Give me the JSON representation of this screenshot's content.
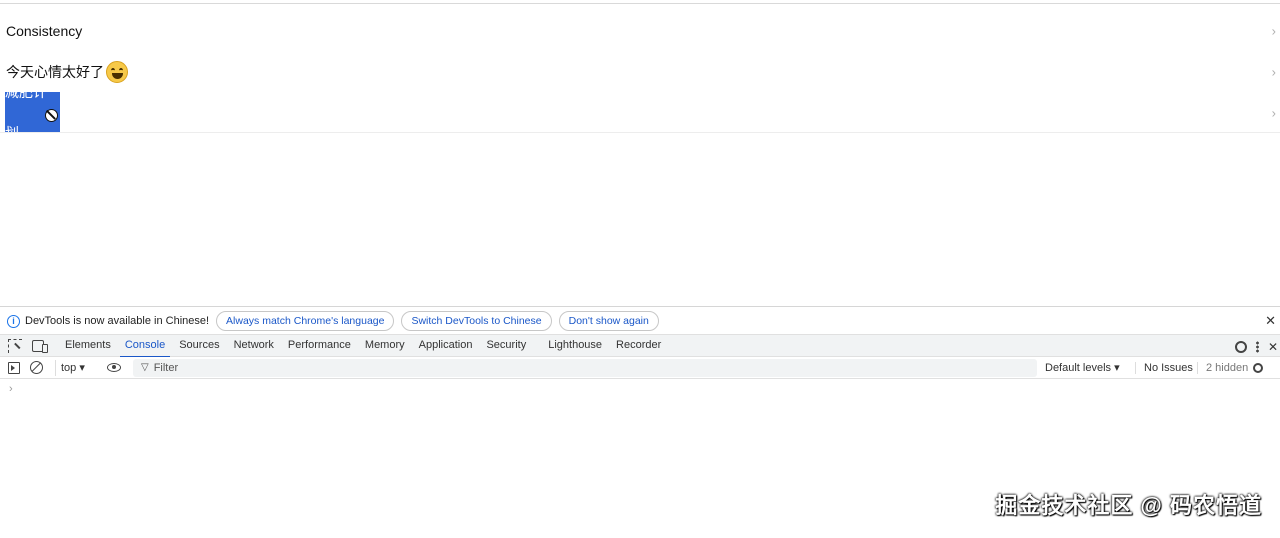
{
  "app": {
    "items": [
      {
        "label": "Consistency",
        "emoji": false
      },
      {
        "label": "今天心情太好了",
        "emoji": true
      },
      {
        "label": "减肥计划",
        "selected": true
      }
    ],
    "chevron": "›"
  },
  "devtools": {
    "infobar": {
      "message": "DevTools is now available in Chinese!",
      "buttons": [
        "Always match Chrome's language",
        "Switch DevTools to Chinese",
        "Don't show again"
      ],
      "close": "✕"
    },
    "tabs": [
      "Elements",
      "Console",
      "Sources",
      "Network",
      "Performance",
      "Memory",
      "Application",
      "Security",
      "Lighthouse",
      "Recorder"
    ],
    "active_tab": "Console",
    "toolbar": {
      "context": "top ▾",
      "filter_placeholder": "Filter",
      "levels": "Default levels ▾",
      "issues": "No Issues",
      "hidden": "2 hidden"
    },
    "prompt": "›",
    "tab_close": "✕"
  },
  "watermark": "掘金技术社区 @ 码农悟道",
  "colors": {
    "selection": "#3067d6",
    "accent": "#1a57c8",
    "emoji": "#f7c948"
  },
  "icons": [
    "info-icon",
    "inspect-element-icon",
    "device-toolbar-icon",
    "settings-gear-icon",
    "more-options-icon",
    "sidebar-toggle-icon",
    "clear-console-icon",
    "eye-icon",
    "filter-icon",
    "not-allowed-cursor-icon",
    "laughing-emoji-icon"
  ]
}
